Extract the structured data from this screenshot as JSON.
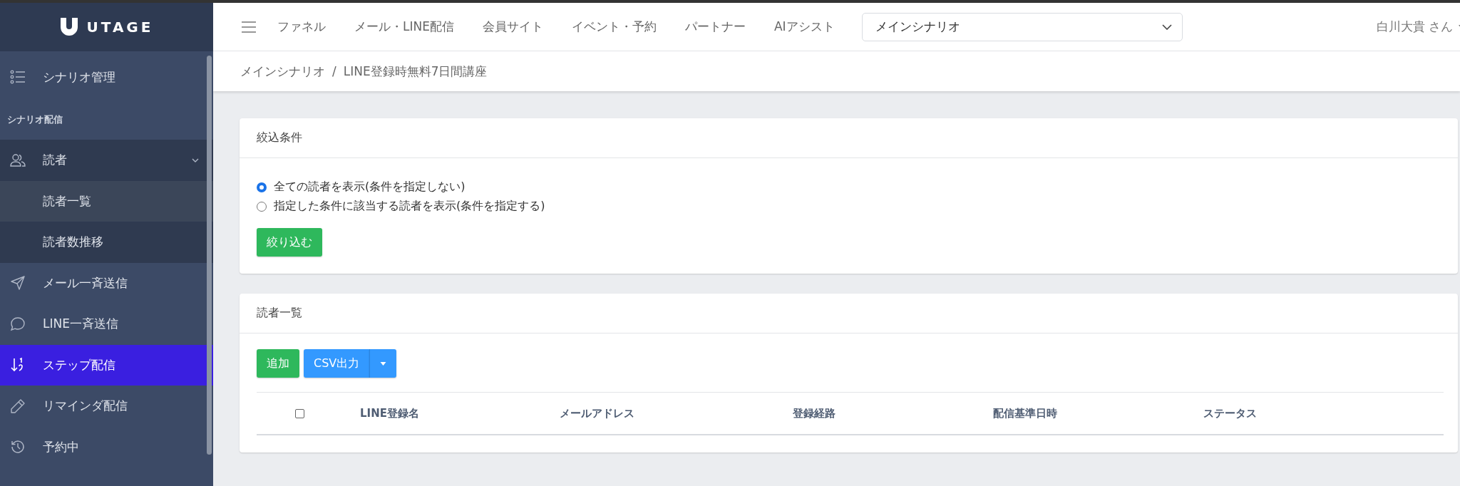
{
  "logo": {
    "text": "UTAGE"
  },
  "sidebar": {
    "items": [
      {
        "kind": "link",
        "label": "シナリオ管理",
        "selected": false
      },
      {
        "kind": "section",
        "label": "シナリオ配信"
      },
      {
        "kind": "group",
        "label": "読者",
        "expanded": true,
        "children": [
          {
            "label": "読者一覧",
            "selected": true
          },
          {
            "label": "読者数推移",
            "selected": false
          }
        ]
      },
      {
        "kind": "link",
        "label": "メール一斉送信",
        "selected": false
      },
      {
        "kind": "link",
        "label": "LINE一斉送信",
        "selected": false
      },
      {
        "kind": "link",
        "label": "ステップ配信",
        "selected": true
      },
      {
        "kind": "link",
        "label": "リマインダ配信",
        "selected": false
      },
      {
        "kind": "link",
        "label": "予約中",
        "selected": false
      }
    ]
  },
  "topnav": {
    "items": [
      "ファネル",
      "メール・LINE配信",
      "会員サイト",
      "イベント・予約",
      "パートナー",
      "AIアシスト"
    ],
    "scenario_select": {
      "value": "メインシナリオ"
    },
    "user": "白川大貴 さん"
  },
  "breadcrumb": {
    "items": [
      "メインシナリオ",
      "LINE登録時無料7日間講座"
    ],
    "separator": "/"
  },
  "filter_card": {
    "title": "絞込条件",
    "options": [
      {
        "label": "全ての読者を表示(条件を指定しない)",
        "selected": true
      },
      {
        "label": "指定した条件に該当する読者を表示(条件を指定する)",
        "selected": false
      }
    ],
    "button": "絞り込む"
  },
  "readers_card": {
    "title": "読者一覧",
    "add_button": "追加",
    "export_button": "CSV出力",
    "table": {
      "select_all": {
        "checked": false
      },
      "columns": [
        "LINE登録名",
        "メールアドレス",
        "登録経路",
        "配信基準日時",
        "ステータス"
      ]
    }
  }
}
